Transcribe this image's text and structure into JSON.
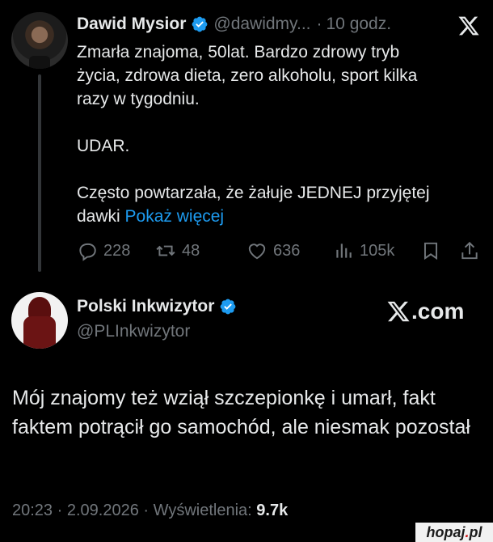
{
  "tweet": {
    "author_name": "Dawid Mysior",
    "handle": "@dawidmy...",
    "separator": "·",
    "time": "10 godz.",
    "lines": [
      "Zmarła znajoma, 50lat. Bardzo zdrowy tryb",
      "życia,  zdrowa dieta, zero alkoholu, sport kilka",
      "razy w tygodniu.",
      "UDAR.",
      "Często powtarzała, że żałuje JEDNEJ przyjętej",
      "dawki"
    ],
    "show_more": "Pokaż więcej",
    "stats": {
      "replies": "228",
      "retweets": "48",
      "likes": "636",
      "views": "105k"
    }
  },
  "reply": {
    "author_name": "Polski Inkwizytor",
    "handle": "@PLInkwizytor",
    "site_label": ".com",
    "text": "Mój znajomy też wziął szczepionkę i umarł, fakt faktem potrącił go samochód, ale niesmak pozostał",
    "time": "20:23",
    "date": "2.09.2026",
    "separator": "·",
    "views_label": "Wyświetlenia:",
    "views": "9.7k"
  },
  "watermark": {
    "text_main": "hopaj",
    "dot": ".",
    "text_tld": "pl"
  },
  "colors": {
    "background": "#000000",
    "text": "#e7e9ea",
    "muted": "#71767b",
    "link": "#1d9bf0",
    "verified": "#1d9bf0"
  },
  "icons": {
    "reply": "speech-bubble-icon",
    "retweet": "retweet-icon",
    "like": "heart-icon",
    "views": "bar-chart-icon",
    "bookmark": "bookmark-icon",
    "share": "share-icon",
    "logo": "x-logo-icon",
    "verified": "verified-badge-icon"
  }
}
